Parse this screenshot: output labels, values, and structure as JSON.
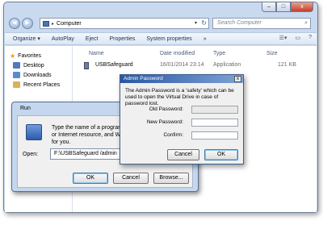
{
  "explorer": {
    "window_buttons": {
      "minimize": "–",
      "maximize": "□",
      "close": "x"
    },
    "address": {
      "root_icon": "▸",
      "location": "Computer",
      "sep": "▸"
    },
    "search_placeholder": "Search Computer",
    "toolbar": {
      "organize": "Organize ▾",
      "autoplay": "AutoPlay",
      "eject": "Eject",
      "properties": "Properties",
      "system_properties": "System properties",
      "more": "»"
    },
    "nav": {
      "favorites": "Favorites",
      "desktop": "Desktop",
      "downloads": "Downloads",
      "recent_places": "Recent Places"
    },
    "columns": {
      "name": "Name",
      "date": "Date modified",
      "type": "Type",
      "size": "Size"
    },
    "file": {
      "name": "USBSafeguard",
      "date": "16/01/2014 23:14",
      "type": "Application",
      "size": "121 KB"
    }
  },
  "run_dialog": {
    "title": "Run",
    "message": "Type the name of a program, folder, document, or Internet resource, and Windows will open it for you.",
    "open_label": "Open:",
    "open_value": "F:\\USBSafeguard /admin",
    "ok": "OK",
    "cancel": "Cancel",
    "browse": "Browse..."
  },
  "admin_dialog": {
    "title": "Admin Password",
    "close": "x",
    "message": "The Admin Password is a 'safety' which can be used to open the Virtual Drive in case of password lost.",
    "old_password": "Old Password:",
    "new_password": "New Password:",
    "confirm": "Confirm:",
    "cancel": "Cancel",
    "ok": "OK"
  }
}
